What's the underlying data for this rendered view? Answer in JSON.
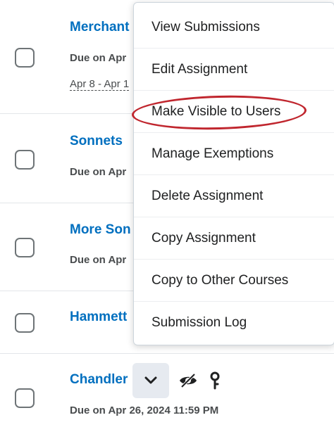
{
  "rows": [
    {
      "title": "Merchant",
      "due": "Due on Apr",
      "range": "Apr 8 - Apr 1"
    },
    {
      "title": "Sonnets",
      "due": "Due on Apr"
    },
    {
      "title": "More Son",
      "due": "Due on Apr"
    },
    {
      "title": "Hammett"
    },
    {
      "title": "Chandler",
      "due": "Due on Apr 26, 2024 11:59 PM"
    }
  ],
  "menu": {
    "items": [
      "View Submissions",
      "Edit Assignment",
      "Make Visible to Users",
      "Manage Exemptions",
      "Delete Assignment",
      "Copy Assignment",
      "Copy to Other Courses",
      "Submission Log"
    ],
    "highlighted_item": "Make Visible to Users"
  },
  "icons": {
    "actions_toggle": "chevron-down-icon",
    "visibility": "eye-hidden-icon",
    "conditions": "key-pin-icon"
  },
  "colors": {
    "link": "#006fbf",
    "highlight_oval": "#c0262e",
    "chevron_button_bg": "#e6eaf0"
  }
}
